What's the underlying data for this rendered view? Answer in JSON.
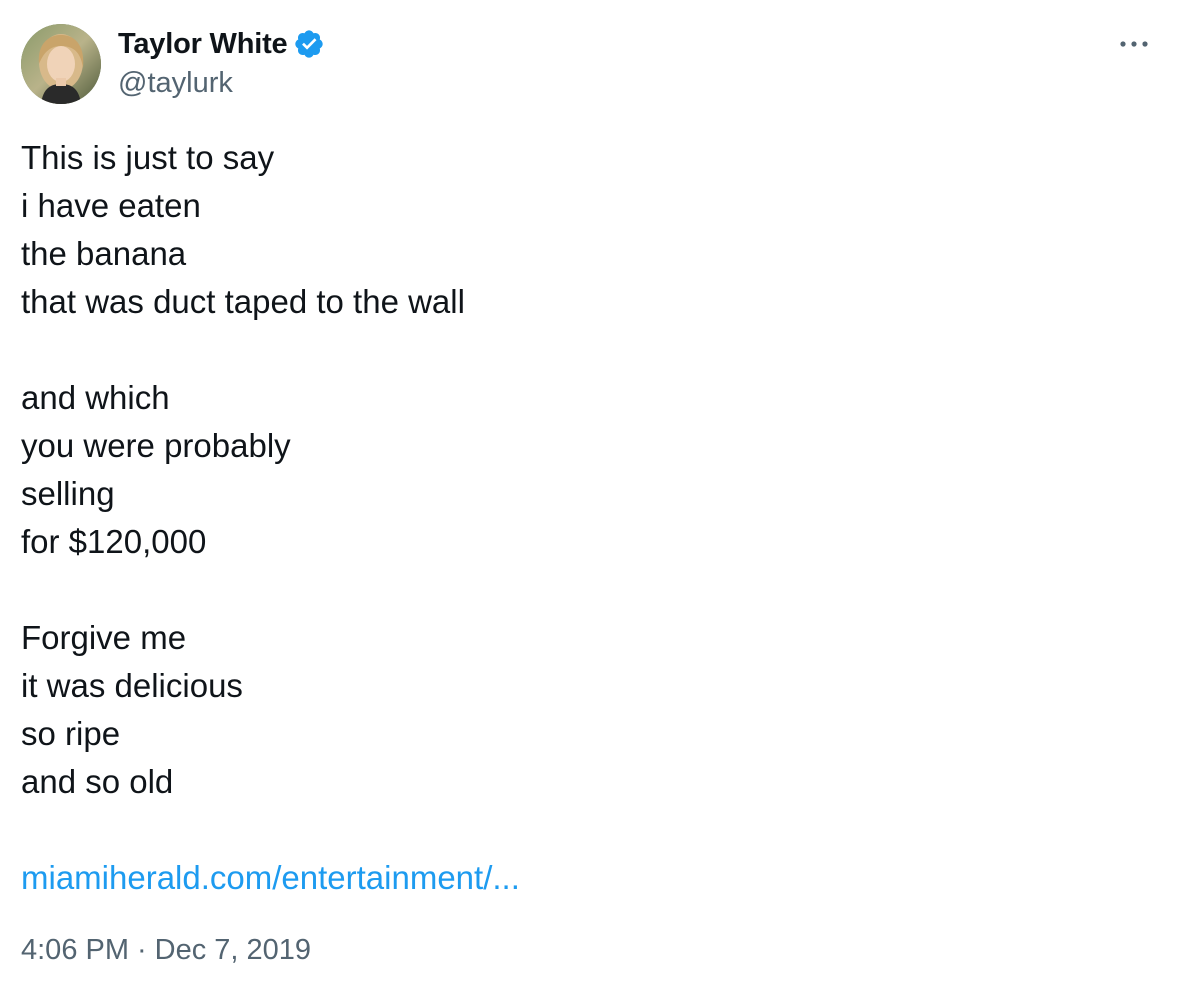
{
  "author": {
    "display_name": "Taylor White",
    "handle": "@taylurk",
    "verified": true,
    "verified_color": "#1d9bf0"
  },
  "tweet": {
    "stanzas": [
      [
        "This is just to say",
        "i have eaten",
        "the banana",
        "that was duct taped to the wall"
      ],
      [
        "and which",
        "you were probably",
        "selling",
        "for $120,000"
      ],
      [
        "Forgive me",
        "it was delicious",
        "so ripe",
        "and so old"
      ]
    ],
    "link_text": "miamiherald.com/entertainment/...",
    "link_color": "#1d9bf0"
  },
  "meta": {
    "time": "4:06 PM",
    "separator": "·",
    "date": "Dec 7, 2019"
  },
  "icons": {
    "verified": "verified-badge-icon",
    "more": "more-options-icon"
  }
}
